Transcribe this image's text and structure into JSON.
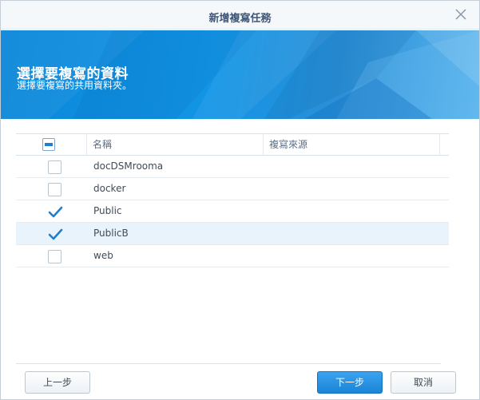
{
  "dialog": {
    "title": "新增複寫任務"
  },
  "banner": {
    "title": "選擇要複寫的資料",
    "subtitle": "選擇要複寫的共用資料夾。"
  },
  "table": {
    "columns": [
      "名稱",
      "複寫來源"
    ],
    "header_checkbox_state": "partial",
    "rows": [
      {
        "name": "docDSMrooma",
        "source": "",
        "checked": false,
        "selected": false
      },
      {
        "name": "docker",
        "source": "",
        "checked": false,
        "selected": false
      },
      {
        "name": "Public",
        "source": "",
        "checked": true,
        "selected": false
      },
      {
        "name": "PublicB",
        "source": "",
        "checked": true,
        "selected": true
      },
      {
        "name": "web",
        "source": "",
        "checked": false,
        "selected": false
      }
    ]
  },
  "buttons": {
    "back": "上一步",
    "next": "下一步",
    "cancel": "取消"
  },
  "colors": {
    "accent": "#1e7fd1",
    "banner": "#1395e6",
    "selected_row": "#e9f3fb"
  },
  "icons": {
    "close": "close-icon",
    "check": "checkmark-icon"
  }
}
